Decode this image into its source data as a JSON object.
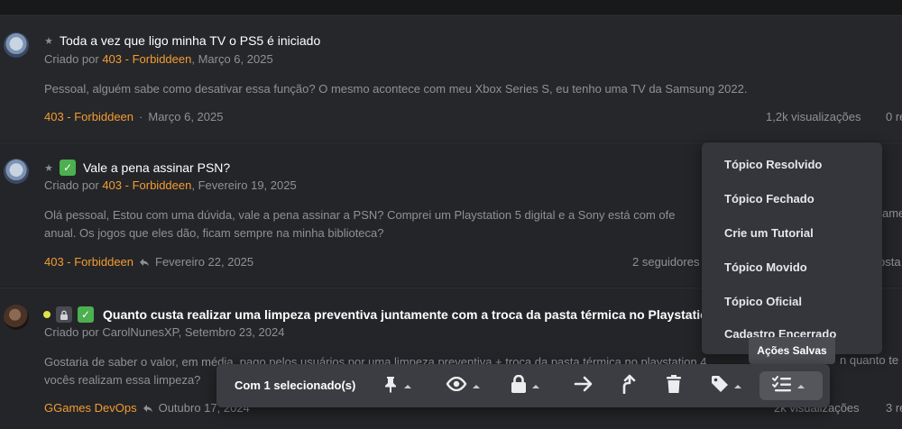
{
  "topics": [
    {
      "title": "Toda a vez que ligo minha TV o PS5 é iniciado",
      "created_prefix": "Criado por",
      "created_author": "403 - Forbiddeen",
      "created_date": ", Março 6, 2025",
      "excerpt": "Pessoal, alguém sabe como desativar essa função? O mesmo acontece com meu Xbox Series S, eu tenho uma TV da Samsung 2022.",
      "footer_author": "403 - Forbiddeen",
      "footer_sep": "·",
      "footer_date": "Março 6, 2025",
      "views": "1,2k visualizações",
      "replies": "0 re"
    },
    {
      "title": "Vale a pena assinar PSN?",
      "created_prefix": "Criado por",
      "created_author": "403 - Forbiddeen",
      "created_date": ", Fevereiro 19, 2025",
      "excerpt_line1": "Olá pessoal, Estou com uma dúvida, vale a pena assinar a PSN? Comprei um Playstation 5 digital e a Sony está com ofe",
      "excerpt_line1_tail": "ame",
      "excerpt_line2": "anual. Os jogos que eles dão, ficam sempre na minha biblioteca?",
      "footer_author": "403 - Forbiddeen",
      "footer_date": "Fevereiro 22, 2025",
      "followers": "2 seguidores",
      "posts": "osta"
    },
    {
      "title": "Quanto custa realizar uma limpeza preventiva juntamente com a troca da pasta térmica no Playstatio",
      "created_prefix": "Criado por",
      "created_author": "CarolNunesXP",
      "created_date": ", Setembro 23, 2024",
      "excerpt_line1": "Gostaria de saber o valor, em média, pago pelos usuários por uma limpeza preventiva + troca da pasta térmica no playstation 4",
      "excerpt_line1_tail": "n quanto te",
      "excerpt_line2": "vocês realizam essa limpeza?",
      "footer_author": "GGames DevOps",
      "footer_date": "Outubro 17, 2024",
      "views": "2k visualizações",
      "replies": "3 re"
    }
  ],
  "dropdown": {
    "items": [
      "Tópico Resolvido",
      "Tópico Fechado",
      "Crie um Tutorial",
      "Tópico Movido",
      "Tópico Oficial",
      "Cadastro Encerrado"
    ]
  },
  "tooltip": "Ações Salvas",
  "toolbar": {
    "selected_label": "Com 1 selecionado(s)",
    "buttons": [
      "pin-icon",
      "eye-icon",
      "lock-icon",
      "arrow-right-icon",
      "merge-up-icon",
      "trash-icon",
      "tag-icon",
      "checklist-icon"
    ]
  },
  "colors": {
    "background": "#202124",
    "topic_bg": "#242528",
    "author_orange": "#f39c32",
    "solved_green": "#4caf50",
    "dropdown_bg": "#35363b",
    "toolbar_bg": "#3c3d42"
  }
}
